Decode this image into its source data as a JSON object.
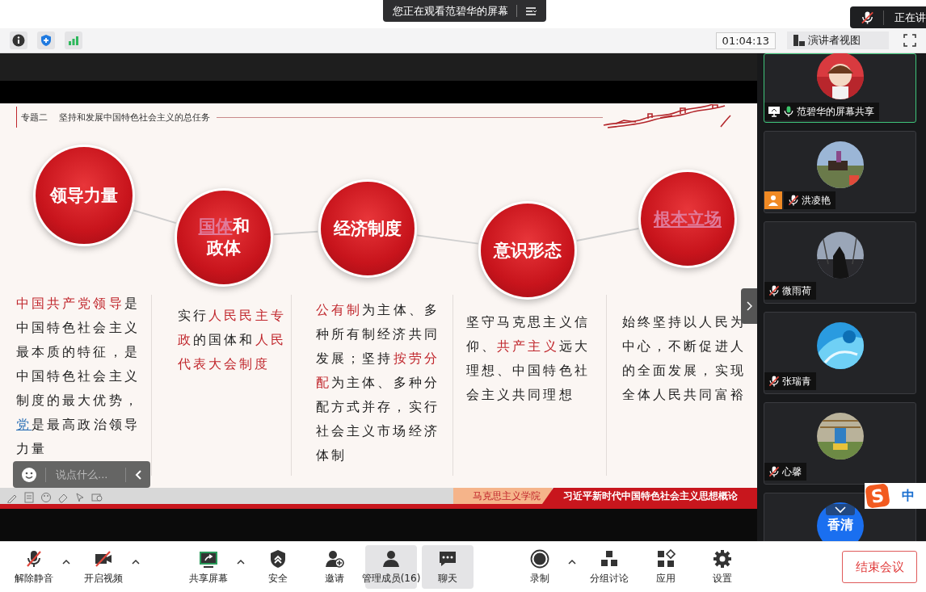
{
  "banner": {
    "text": "您正在观看范碧华的屏幕"
  },
  "speaking_notice": {
    "text": "正在讲"
  },
  "info_bar": {
    "timer": "01:04:13",
    "view_button": "演讲者视图"
  },
  "slide": {
    "topic": "专题二",
    "subtitle": "坚持和发展中国特色社会主义的总任务",
    "nodes": [
      {
        "lines": [
          [
            {
              "text": "领导力量",
              "kind": "plain"
            }
          ]
        ]
      },
      {
        "lines": [
          [
            {
              "text": "国体",
              "kind": "link"
            },
            {
              "text": "和",
              "kind": "plain"
            }
          ],
          [
            {
              "text": "政体",
              "kind": "plain"
            }
          ]
        ]
      },
      {
        "lines": [
          [
            {
              "text": "经济制度",
              "kind": "plain"
            }
          ]
        ]
      },
      {
        "lines": [
          [
            {
              "text": "意识形态",
              "kind": "plain"
            }
          ]
        ]
      },
      {
        "lines": [
          [
            {
              "text": "根本立场",
              "kind": "link"
            }
          ]
        ]
      }
    ],
    "columns": [
      {
        "segments": [
          {
            "text": "中国共产党领导",
            "kind": "red"
          },
          {
            "text": "是中国特色社会主义最本质的特征，是中国特色社会主义制度的最大优势，",
            "kind": "plain"
          },
          {
            "text": "党",
            "kind": "link"
          },
          {
            "text": "是最高政治领导力量",
            "kind": "plain"
          }
        ]
      },
      {
        "segments": [
          {
            "text": "实行",
            "kind": "plain"
          },
          {
            "text": "人民民主专政",
            "kind": "red"
          },
          {
            "text": "的国体和",
            "kind": "plain"
          },
          {
            "text": "人民代表大会制度",
            "kind": "red"
          }
        ]
      },
      {
        "segments": [
          {
            "text": "公有制",
            "kind": "red"
          },
          {
            "text": "为主体、多种所有制经济共同发展；坚持",
            "kind": "plain"
          },
          {
            "text": "按劳分配",
            "kind": "red"
          },
          {
            "text": "为主体、多种分配方式并存，实行社会主义市场经济体制",
            "kind": "plain"
          }
        ]
      },
      {
        "segments": [
          {
            "text": "坚守马克思主义信仰、",
            "kind": "plain"
          },
          {
            "text": "共产主义",
            "kind": "red"
          },
          {
            "text": "远大理想、中国特色社会主义共同理想",
            "kind": "plain"
          }
        ]
      },
      {
        "segments": [
          {
            "text": "始终坚持以人民为中心，不断促进人的全面发展，实现全体人民共同富裕",
            "kind": "plain"
          }
        ]
      }
    ],
    "footer": {
      "school": "马克思主义学院",
      "course": "习近平新时代中国特色社会主义思想概论"
    }
  },
  "chat_box": {
    "placeholder": "说点什么..."
  },
  "participants": [
    {
      "name": "范碧华的屏幕共享",
      "kind": "screen-share",
      "muted": false,
      "host": false,
      "selected": true
    },
    {
      "name": "洪凌艳",
      "kind": "member",
      "muted": true,
      "host": true,
      "selected": false
    },
    {
      "name": "微雨荷",
      "kind": "member",
      "muted": true,
      "host": false,
      "selected": false
    },
    {
      "name": "张瑞青",
      "kind": "member",
      "muted": true,
      "host": false,
      "selected": false
    },
    {
      "name": "心馨",
      "kind": "member",
      "muted": true,
      "host": false,
      "selected": false
    }
  ],
  "partial_tile": {
    "avatar_text": "香清"
  },
  "ime": {
    "logo": "S",
    "mode": "中"
  },
  "toolbar": [
    {
      "label": "解除静音",
      "kind": "mic-off",
      "caret": true,
      "selected": false
    },
    {
      "label": "开启视频",
      "kind": "video-off",
      "caret": true,
      "selected": false
    },
    {
      "label": "共享屏幕",
      "kind": "share",
      "caret": true,
      "selected": false
    },
    {
      "label": "安全",
      "kind": "shield",
      "caret": false,
      "selected": false
    },
    {
      "label": "邀请",
      "kind": "invite",
      "caret": false,
      "selected": false
    },
    {
      "label": "管理成员(16)",
      "kind": "members",
      "caret": false,
      "selected": true
    },
    {
      "label": "聊天",
      "kind": "chat",
      "caret": false,
      "selected": true
    },
    {
      "label": "录制",
      "kind": "record",
      "caret": true,
      "selected": false
    },
    {
      "label": "分组讨论",
      "kind": "groups",
      "caret": false,
      "selected": false
    },
    {
      "label": "应用",
      "kind": "apps",
      "caret": false,
      "selected": false
    },
    {
      "label": "设置",
      "kind": "settings",
      "caret": false,
      "selected": false
    }
  ],
  "end_button": {
    "label": "结束会议"
  }
}
